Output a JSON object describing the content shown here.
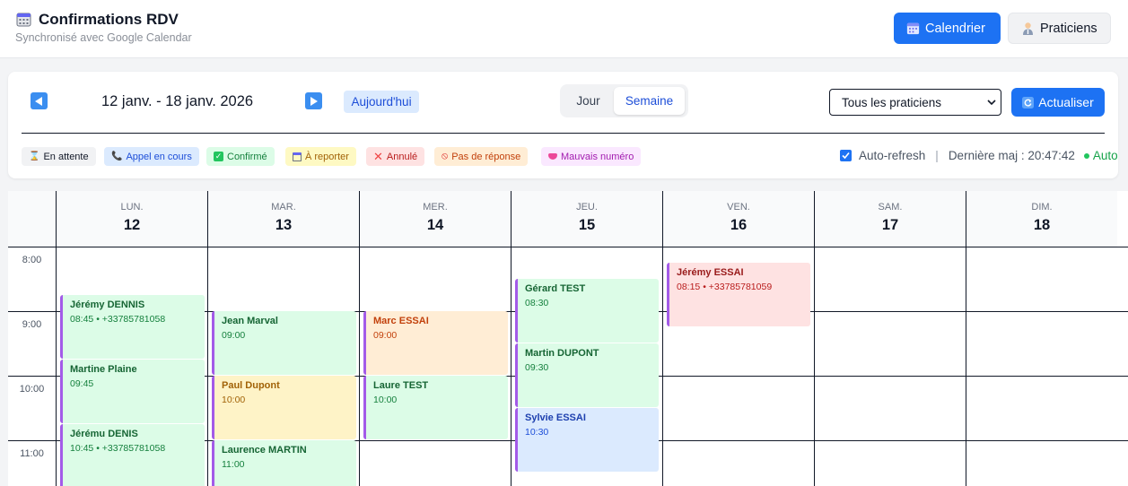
{
  "header": {
    "title": "Confirmations RDV",
    "subtitle": "Synchronisé avec Google Calendar",
    "title_icon": "calendar-icon",
    "buttons": {
      "calendar": "Calendrier",
      "practitioners": "Praticiens"
    }
  },
  "toolbar": {
    "range": "12 janv. - 18 janv. 2026",
    "today": "Aujourd'hui",
    "view_day": "Jour",
    "view_week": "Semaine",
    "practitioner_select": "Tous les praticiens",
    "refresh": "Actualiser"
  },
  "legend": [
    {
      "label": "En attente",
      "icon": "hourglass-icon",
      "bg": "#f1f2f4",
      "color": "#111827"
    },
    {
      "label": "Appel en cours",
      "icon": "phone-icon",
      "bg": "#dbeafe",
      "color": "#1d4ed8"
    },
    {
      "label": "Confirmé",
      "icon": "check-icon",
      "bg": "#dcfce7",
      "color": "#15803d"
    },
    {
      "label": "À reporter",
      "icon": "calendar-icon",
      "bg": "#fef9c3",
      "color": "#a16207"
    },
    {
      "label": "Annulé",
      "icon": "cross-icon",
      "bg": "#fee2e2",
      "color": "#b91c1c"
    },
    {
      "label": "Pas de réponse",
      "icon": "no-entry-icon",
      "bg": "#ffedd5",
      "color": "#c2410c"
    },
    {
      "label": "Mauvais numéro",
      "icon": "mask-icon",
      "bg": "#fae8ff",
      "color": "#a21caf"
    }
  ],
  "status": {
    "auto_refresh_label": "Auto-refresh",
    "auto_refresh_checked": true,
    "separator": "|",
    "last_update": "Dernière maj : 20:47:42",
    "auto": "Auto"
  },
  "days": [
    {
      "name": "LUN.",
      "num": "12"
    },
    {
      "name": "MAR.",
      "num": "13"
    },
    {
      "name": "MER.",
      "num": "14"
    },
    {
      "name": "JEU.",
      "num": "15"
    },
    {
      "name": "VEN.",
      "num": "16"
    },
    {
      "name": "SAM.",
      "num": "17"
    },
    {
      "name": "DIM.",
      "num": "18"
    }
  ],
  "hours": [
    "8:00",
    "9:00",
    "10:00",
    "11:00"
  ],
  "events": [
    {
      "name": "Jérémy DENNIS",
      "info": "08:45 • +33785781058",
      "status": "confirme"
    },
    {
      "name": "Martine Plaine",
      "info": "09:45",
      "status": "confirme"
    },
    {
      "name": "Jérému DENIS",
      "info": "10:45 • +33785781058",
      "status": "confirme"
    },
    {
      "name": "Jean Marval",
      "info": "09:00",
      "status": "confirme"
    },
    {
      "name": "Paul Dupont",
      "info": "10:00",
      "status": "a-reporter"
    },
    {
      "name": "Laurence MARTIN",
      "info": "11:00",
      "status": "confirme"
    },
    {
      "name": "Marc ESSAI",
      "info": "09:00",
      "status": "pas-de-reponse"
    },
    {
      "name": "Laure TEST",
      "info": "10:00",
      "status": "confirme"
    },
    {
      "name": "Gérard TEST",
      "info": "08:30",
      "status": "confirme"
    },
    {
      "name": "Martin DUPONT",
      "info": "09:30",
      "status": "confirme"
    },
    {
      "name": "Sylvie ESSAI",
      "info": "10:30",
      "status": "appel-en-cours"
    },
    {
      "name": "Jérémy ESSAI",
      "info": "08:15 • +33785781059",
      "status": "annule"
    }
  ],
  "colors": {
    "primary": "#1d72f3",
    "event_accent": "#a35be8"
  }
}
